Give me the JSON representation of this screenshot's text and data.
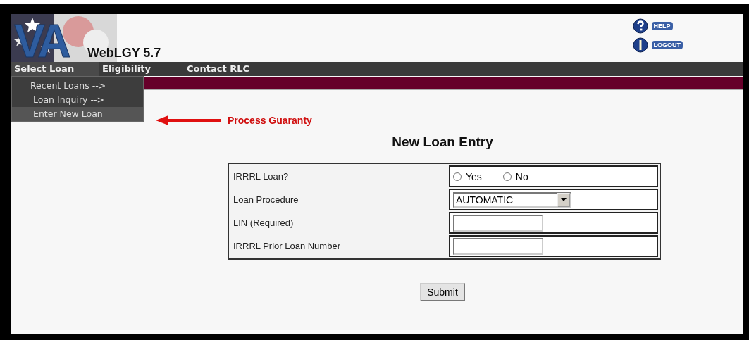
{
  "header": {
    "logo": "VA",
    "app_name": "WebLGY 5.7",
    "links": [
      {
        "kind": "help",
        "label": "HELP"
      },
      {
        "kind": "info",
        "label": "LOGOUT"
      }
    ]
  },
  "nav": [
    {
      "label": "Select Loan",
      "selected": true
    },
    {
      "label": "Eligibility",
      "selected": false
    },
    {
      "label": "Contact RLC",
      "selected": false
    }
  ],
  "menu": [
    {
      "label": "Recent Loans -->",
      "selected": false
    },
    {
      "label": "Loan Inquiry -->",
      "selected": false
    },
    {
      "label": "Enter New Loan",
      "selected": true
    }
  ],
  "annotation": "Process Guaranty",
  "form": {
    "title": "New Loan Entry",
    "rows": [
      {
        "kind": "radio",
        "label": "IRRRL Loan?",
        "options": [
          {
            "label": "Yes",
            "selected": false
          },
          {
            "label": "No",
            "selected": false
          }
        ]
      },
      {
        "kind": "select",
        "label": "Loan Procedure",
        "value": "AUTOMATIC"
      },
      {
        "kind": "text",
        "label": "LIN (Required)"
      },
      {
        "kind": "text",
        "label": "IRRRL Prior Loan Number"
      }
    ],
    "submit": "Submit"
  }
}
